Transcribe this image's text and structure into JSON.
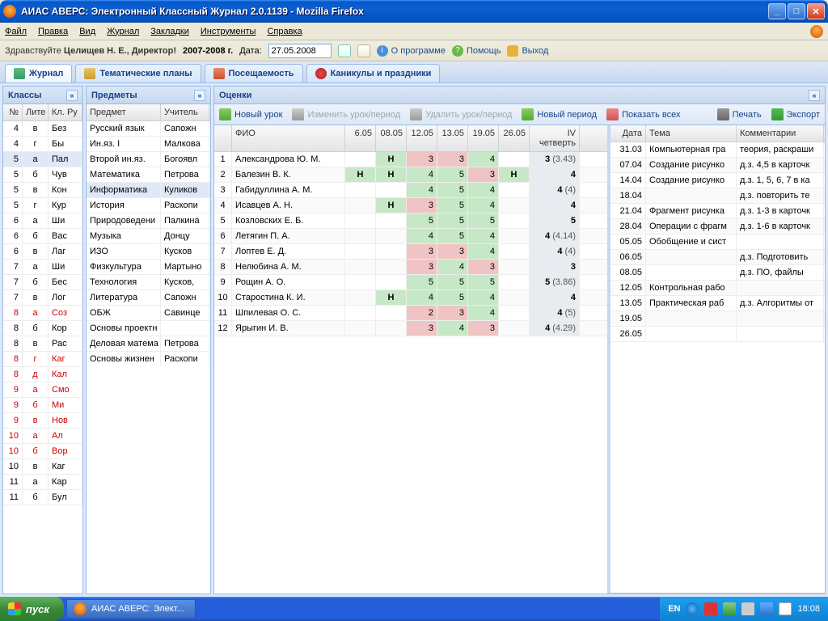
{
  "window": {
    "title": "АИАС АВЕРС: Электронный Классный Журнал 2.0.1139 - Mozilla Firefox"
  },
  "ffmenu": {
    "file": "Файл",
    "edit": "Правка",
    "view": "Вид",
    "journal": "Журнал",
    "bookmarks": "Закладки",
    "tools": "Инструменты",
    "help": "Справка"
  },
  "infobar": {
    "greeting": "Здравствуйте ",
    "user": "Целищев Н. Е., Директор!",
    "year": "2007-2008 г.",
    "date_label": "Дата:",
    "date_value": "27.05.2008",
    "about": "О программе",
    "help": "Помощь",
    "exit": "Выход"
  },
  "tabs": {
    "journal": "Журнал",
    "themes": "Тематические планы",
    "attendance": "Посещаемость",
    "holidays": "Каникулы и праздники"
  },
  "panels": {
    "classes": "Классы",
    "subjects": "Предметы",
    "grades": "Оценки"
  },
  "classes": {
    "headers": {
      "no": "№",
      "lit": "Лите",
      "ruk": "Кл. Ру"
    },
    "rows": [
      {
        "no": "4",
        "lit": "в",
        "ruk": "Без",
        "red": false
      },
      {
        "no": "4",
        "lit": "г",
        "ruk": "Бы",
        "red": false
      },
      {
        "no": "5",
        "lit": "а",
        "ruk": "Пал",
        "red": false,
        "sel": true
      },
      {
        "no": "5",
        "lit": "б",
        "ruk": "Чув",
        "red": false
      },
      {
        "no": "5",
        "lit": "в",
        "ruk": "Кон",
        "red": false
      },
      {
        "no": "5",
        "lit": "г",
        "ruk": "Кур",
        "red": false
      },
      {
        "no": "6",
        "lit": "а",
        "ruk": "Ши",
        "red": false
      },
      {
        "no": "6",
        "lit": "б",
        "ruk": "Вас",
        "red": false
      },
      {
        "no": "6",
        "lit": "в",
        "ruk": "Лаг",
        "red": false
      },
      {
        "no": "7",
        "lit": "а",
        "ruk": "Ши",
        "red": false
      },
      {
        "no": "7",
        "lit": "б",
        "ruk": "Бес",
        "red": false
      },
      {
        "no": "7",
        "lit": "в",
        "ruk": "Лог",
        "red": false
      },
      {
        "no": "8",
        "lit": "а",
        "ruk": "Соз",
        "red": true
      },
      {
        "no": "8",
        "lit": "б",
        "ruk": "Кор",
        "red": false
      },
      {
        "no": "8",
        "lit": "в",
        "ruk": "Рас",
        "red": false
      },
      {
        "no": "8",
        "lit": "г",
        "ruk": "Каг",
        "red": true
      },
      {
        "no": "8",
        "lit": "д",
        "ruk": "Кал",
        "red": true
      },
      {
        "no": "9",
        "lit": "а",
        "ruk": "Смо",
        "red": true
      },
      {
        "no": "9",
        "lit": "б",
        "ruk": "Ми",
        "red": true
      },
      {
        "no": "9",
        "lit": "в",
        "ruk": "Нов",
        "red": true
      },
      {
        "no": "10",
        "lit": "а",
        "ruk": "Ал",
        "red": true
      },
      {
        "no": "10",
        "lit": "б",
        "ruk": "Вор",
        "red": true
      },
      {
        "no": "10",
        "lit": "в",
        "ruk": "Каг",
        "red": false
      },
      {
        "no": "11",
        "lit": "а",
        "ruk": "Кар",
        "red": false
      },
      {
        "no": "11",
        "lit": "б",
        "ruk": "Бул",
        "red": false
      }
    ]
  },
  "subjects": {
    "headers": {
      "subj": "Предмет",
      "teach": "Учитель"
    },
    "rows": [
      {
        "s": "Русский язык",
        "t": "Сапожн"
      },
      {
        "s": "Ин.яз. I",
        "t": "Малкова"
      },
      {
        "s": "Второй ин.яз.",
        "t": "Богоявл"
      },
      {
        "s": "Математика",
        "t": "Петрова"
      },
      {
        "s": "Информатика",
        "t": "Куликов",
        "sel": true
      },
      {
        "s": "История",
        "t": "Раскопи"
      },
      {
        "s": "Природоведени",
        "t": "Палкина"
      },
      {
        "s": "Музыка",
        "t": "Донцу"
      },
      {
        "s": "ИЗО",
        "t": "Кусков"
      },
      {
        "s": "Физкультура",
        "t": "Мартыно"
      },
      {
        "s": "Технология",
        "t": "Кусков,"
      },
      {
        "s": "Литература",
        "t": "Сапожн"
      },
      {
        "s": "ОБЖ",
        "t": "Савинце"
      },
      {
        "s": "Основы проектн",
        "t": ""
      },
      {
        "s": "Деловая матема",
        "t": "Петрова"
      },
      {
        "s": "Основы жизнен",
        "t": "Раскопи"
      }
    ]
  },
  "toolbar": {
    "new_lesson": "Новый урок",
    "edit_lesson": "Изменить урок/период",
    "del_lesson": "Удалить урок/период",
    "new_period": "Новый период",
    "show_all": "Показать всех",
    "print": "Печать",
    "export": "Экспорт"
  },
  "marks": {
    "headers": {
      "fio": "ФИО",
      "d1": "6.05",
      "d2": "08.05",
      "d3": "12.05",
      "d4": "13.05",
      "d5": "19.05",
      "d6": "26.05",
      "q": "IV четверть"
    },
    "rows": [
      {
        "i": 1,
        "n": "Александрова Ю. М.",
        "c": [
          {
            "v": ""
          },
          {
            "v": "Н",
            "n": true,
            "g": true
          },
          {
            "v": "3",
            "r": true
          },
          {
            "v": "3",
            "r": true
          },
          {
            "v": "4",
            "g": true
          },
          {
            "v": ""
          }
        ],
        "q": "3",
        "avg": "(3.43)"
      },
      {
        "i": 2,
        "n": "Балезин В. К.",
        "c": [
          {
            "v": "Н",
            "n": true,
            "g": true
          },
          {
            "v": "Н",
            "n": true,
            "g": true
          },
          {
            "v": "4",
            "g": true
          },
          {
            "v": "5",
            "g": true
          },
          {
            "v": "3",
            "r": true
          },
          {
            "v": "Н",
            "n": true,
            "g": true
          }
        ],
        "q": "4",
        "avg": ""
      },
      {
        "i": 3,
        "n": "Габидуллина А. М.",
        "c": [
          {
            "v": ""
          },
          {
            "v": ""
          },
          {
            "v": "4",
            "g": true
          },
          {
            "v": "5",
            "g": true
          },
          {
            "v": "4",
            "g": true
          },
          {
            "v": ""
          }
        ],
        "q": "4",
        "avg": "(4)"
      },
      {
        "i": 4,
        "n": "Исавцев А. Н.",
        "c": [
          {
            "v": ""
          },
          {
            "v": "Н",
            "n": true,
            "g": true
          },
          {
            "v": "3",
            "r": true
          },
          {
            "v": "5",
            "g": true
          },
          {
            "v": "4",
            "g": true
          },
          {
            "v": ""
          }
        ],
        "q": "4",
        "avg": ""
      },
      {
        "i": 5,
        "n": "Козловских Е. Б.",
        "c": [
          {
            "v": ""
          },
          {
            "v": ""
          },
          {
            "v": "5",
            "g": true
          },
          {
            "v": "5",
            "g": true
          },
          {
            "v": "5",
            "g": true
          },
          {
            "v": ""
          }
        ],
        "q": "5",
        "avg": ""
      },
      {
        "i": 6,
        "n": "Летягин П. А.",
        "c": [
          {
            "v": ""
          },
          {
            "v": ""
          },
          {
            "v": "4",
            "g": true
          },
          {
            "v": "5",
            "g": true
          },
          {
            "v": "4",
            "g": true
          },
          {
            "v": ""
          }
        ],
        "q": "4",
        "avg": "(4.14)"
      },
      {
        "i": 7,
        "n": "Лоптев Е. Д.",
        "c": [
          {
            "v": ""
          },
          {
            "v": ""
          },
          {
            "v": "3",
            "r": true
          },
          {
            "v": "3",
            "r": true
          },
          {
            "v": "4",
            "g": true
          },
          {
            "v": ""
          }
        ],
        "q": "4",
        "avg": "(4)"
      },
      {
        "i": 8,
        "n": "Нелюбина А. М.",
        "c": [
          {
            "v": ""
          },
          {
            "v": ""
          },
          {
            "v": "3",
            "r": true
          },
          {
            "v": "4",
            "g": true
          },
          {
            "v": "3",
            "r": true
          },
          {
            "v": ""
          }
        ],
        "q": "3",
        "avg": ""
      },
      {
        "i": 9,
        "n": "Рощин А. О.",
        "c": [
          {
            "v": ""
          },
          {
            "v": ""
          },
          {
            "v": "5",
            "g": true
          },
          {
            "v": "5",
            "g": true
          },
          {
            "v": "5",
            "g": true
          },
          {
            "v": ""
          }
        ],
        "q": "5",
        "avg": "(3.86)"
      },
      {
        "i": 10,
        "n": "Старостина К. И.",
        "c": [
          {
            "v": ""
          },
          {
            "v": "Н",
            "n": true,
            "g": true
          },
          {
            "v": "4",
            "g": true
          },
          {
            "v": "5",
            "g": true
          },
          {
            "v": "4",
            "g": true
          },
          {
            "v": ""
          }
        ],
        "q": "4",
        "avg": ""
      },
      {
        "i": 11,
        "n": "Шпилевая О. С.",
        "c": [
          {
            "v": ""
          },
          {
            "v": ""
          },
          {
            "v": "2",
            "r": true
          },
          {
            "v": "3",
            "r": true
          },
          {
            "v": "4",
            "g": true
          },
          {
            "v": ""
          }
        ],
        "q": "4",
        "avg": "(5)"
      },
      {
        "i": 12,
        "n": "Ярыгин И. В.",
        "c": [
          {
            "v": ""
          },
          {
            "v": ""
          },
          {
            "v": "3",
            "r": true
          },
          {
            "v": "4",
            "g": true
          },
          {
            "v": "3",
            "r": true
          },
          {
            "v": ""
          }
        ],
        "q": "4",
        "avg": "(4.29)"
      }
    ]
  },
  "topics": {
    "headers": {
      "date": "Дата",
      "topic": "Тема",
      "comm": "Комментарии"
    },
    "rows": [
      {
        "d": "31.03",
        "t": "Компьютерная гра",
        "c": "теория, раскраши"
      },
      {
        "d": "07.04",
        "t": "Создание рисунко",
        "c": "д.з. 4,5 в карточк"
      },
      {
        "d": "14.04",
        "t": "Создание рисунко",
        "c": "д.з. 1, 5, 6, 7 в ка"
      },
      {
        "d": "18.04",
        "t": "",
        "c": "д.з. повторить те"
      },
      {
        "d": "21.04",
        "t": "Фрагмент рисунка",
        "c": "д.з. 1-3 в карточк"
      },
      {
        "d": "28.04",
        "t": "Операции с фрагм",
        "c": "д.з. 1-6 в карточк"
      },
      {
        "d": "05.05",
        "t": "Обобщение и сист",
        "c": ""
      },
      {
        "d": "06.05",
        "t": "",
        "c": "д.з. Подготовить"
      },
      {
        "d": "08.05",
        "t": "",
        "c": "д.з. ПО, файлы"
      },
      {
        "d": "12.05",
        "t": "Контрольная рабо",
        "c": ""
      },
      {
        "d": "13.05",
        "t": "Практическая раб",
        "c": "д.з. Алгоритмы от"
      },
      {
        "d": "19.05",
        "t": "",
        "c": ""
      },
      {
        "d": "26.05",
        "t": "",
        "c": ""
      }
    ]
  },
  "taskbar": {
    "start": "пуск",
    "app": "АИАС АВЕРС: Элект...",
    "lang": "EN",
    "time": "18:08"
  }
}
